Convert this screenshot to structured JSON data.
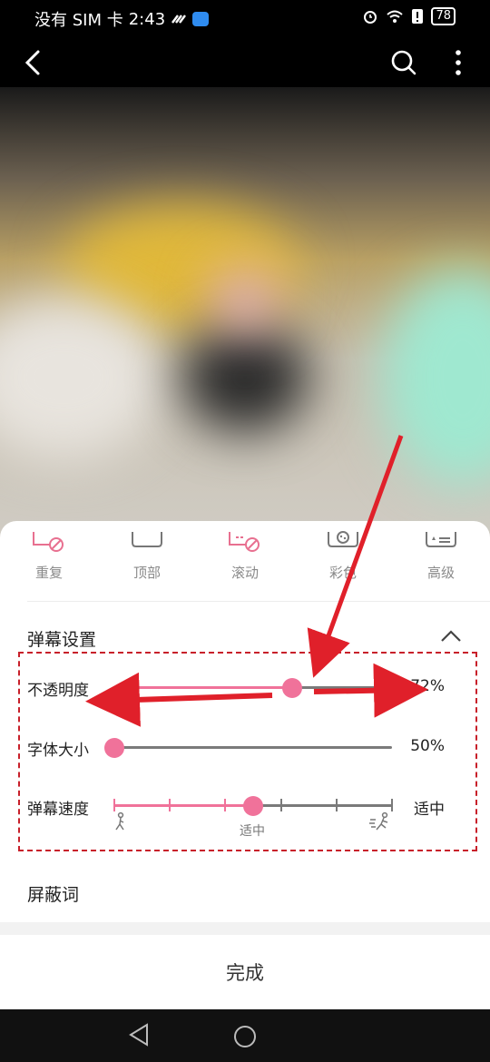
{
  "status_bar": {
    "left_text": "没有 SIM 卡",
    "time": "2:43",
    "battery": "78"
  },
  "toolbar": {
    "back_icon": "back-arrow-icon",
    "search_icon": "search-icon",
    "more_icon": "more-vertical-icon"
  },
  "danmaku_modes": [
    {
      "label": "重复",
      "icon": "repeat-block-icon"
    },
    {
      "label": "顶部",
      "icon": "top-icon"
    },
    {
      "label": "滚动",
      "icon": "scroll-block-icon"
    },
    {
      "label": "彩色",
      "icon": "palette-icon"
    },
    {
      "label": "高级",
      "icon": "advanced-icon"
    }
  ],
  "settings": {
    "title": "弹幕设置",
    "opacity": {
      "label": "不透明度",
      "value_text": "72%",
      "value": 0.64
    },
    "font_size": {
      "label": "字体大小",
      "value_text": "50%",
      "value": 0.0
    },
    "speed": {
      "label": "弹幕速度",
      "value_text": "适中",
      "mid_label": "适中",
      "value": 0.5,
      "steps": 6
    }
  },
  "blocked_words": {
    "label": "屏蔽词"
  },
  "done_button": {
    "label": "完成"
  },
  "colors": {
    "accent": "#f0729a",
    "annotation": "#e0202a"
  }
}
